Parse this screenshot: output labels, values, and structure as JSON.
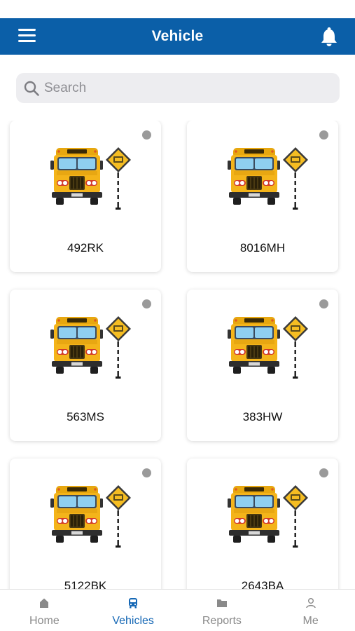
{
  "header": {
    "title": "Vehicle"
  },
  "search": {
    "placeholder": "Search"
  },
  "vehicles": [
    {
      "label": "492RK"
    },
    {
      "label": "8016MH"
    },
    {
      "label": "563MS"
    },
    {
      "label": "383HW"
    },
    {
      "label": "5122BK"
    },
    {
      "label": "2643BA"
    }
  ],
  "bus_sign_text": "SCHOOL BUS",
  "tabs": [
    {
      "label": "Home",
      "icon": "home-icon"
    },
    {
      "label": "Vehicles",
      "icon": "bus-icon"
    },
    {
      "label": "Reports",
      "icon": "folder-icon"
    },
    {
      "label": "Me",
      "icon": "person-icon"
    }
  ],
  "colors": {
    "header_bg": "#0b5fa8",
    "active_tab": "#1668b5",
    "inactive_tab": "#8a8a8a",
    "status_offline": "#9a9a9a",
    "bus_yellow": "#f4b41a"
  }
}
